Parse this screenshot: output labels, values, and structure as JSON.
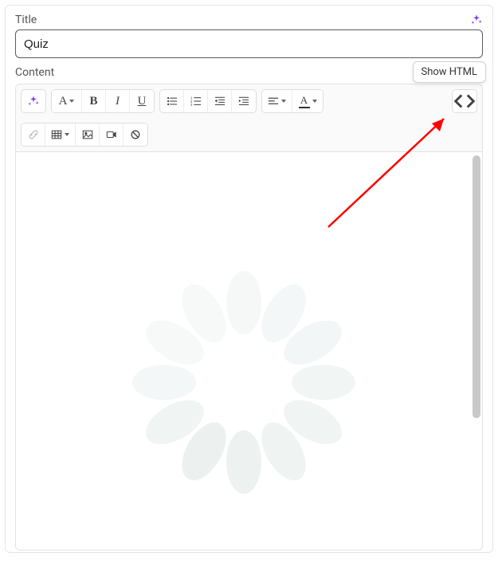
{
  "title": {
    "label": "Title",
    "value": "Quiz"
  },
  "content": {
    "label": "Content"
  },
  "tooltip": {
    "show_html": "Show HTML"
  },
  "icons": {
    "sparkle": "sparkle-icon",
    "font": "A",
    "bold": "B",
    "italic": "I",
    "underline": "U",
    "code": "<>"
  }
}
